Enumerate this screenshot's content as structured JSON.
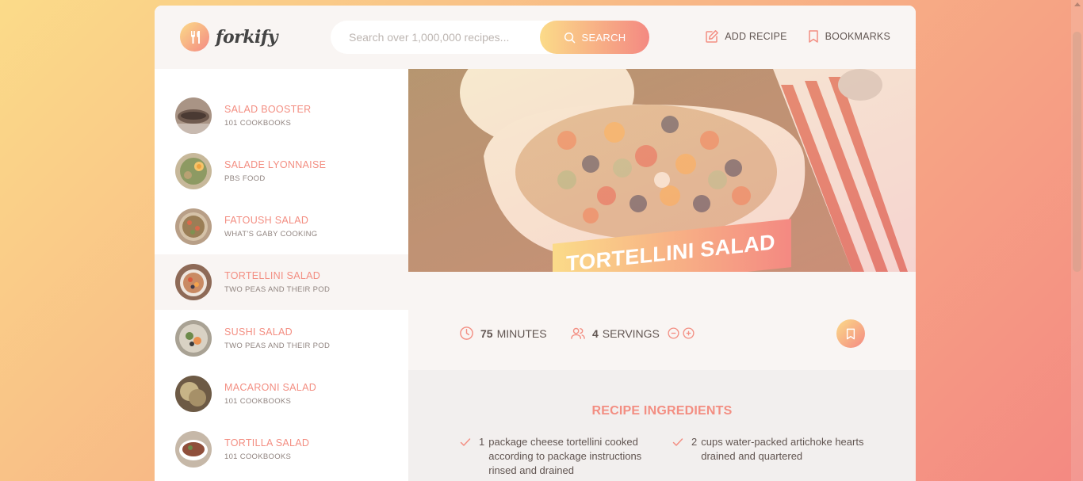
{
  "header": {
    "logo_text": "forkify",
    "search_placeholder": "Search over 1,000,000 recipes...",
    "search_label": "SEARCH",
    "add_recipe_label": "ADD RECIPE",
    "bookmarks_label": "BOOKMARKS"
  },
  "results": [
    {
      "title": "SALAD BOOSTER",
      "publisher": "101 COOKBOOKS",
      "active": false
    },
    {
      "title": "SALADE LYONNAISE",
      "publisher": "PBS FOOD",
      "active": false
    },
    {
      "title": "FATOUSH SALAD",
      "publisher": "WHAT'S GABY COOKING",
      "active": false
    },
    {
      "title": "TORTELLINI SALAD",
      "publisher": "TWO PEAS AND THEIR POD",
      "active": true
    },
    {
      "title": "SUSHI SALAD",
      "publisher": "TWO PEAS AND THEIR POD",
      "active": false
    },
    {
      "title": "MACARONI SALAD",
      "publisher": "101 COOKBOOKS",
      "active": false
    },
    {
      "title": "TORTILLA SALAD",
      "publisher": "101 COOKBOOKS",
      "active": false
    }
  ],
  "recipe": {
    "title": "TORTELLINI SALAD",
    "minutes": "75",
    "minutes_label": "MINUTES",
    "servings": "4",
    "servings_label": "SERVINGS",
    "ingredients_heading": "RECIPE INGREDIENTS",
    "ingredients": [
      {
        "qty": "1",
        "desc": "package cheese tortellini cooked according to package instructions rinsed and drained"
      },
      {
        "qty": "2",
        "desc": "cups water-packed artichoke hearts drained and quartered"
      }
    ]
  },
  "colors": {
    "accent": "#f38e82",
    "gradient_start": "#fbdb89",
    "gradient_end": "#f48982"
  }
}
